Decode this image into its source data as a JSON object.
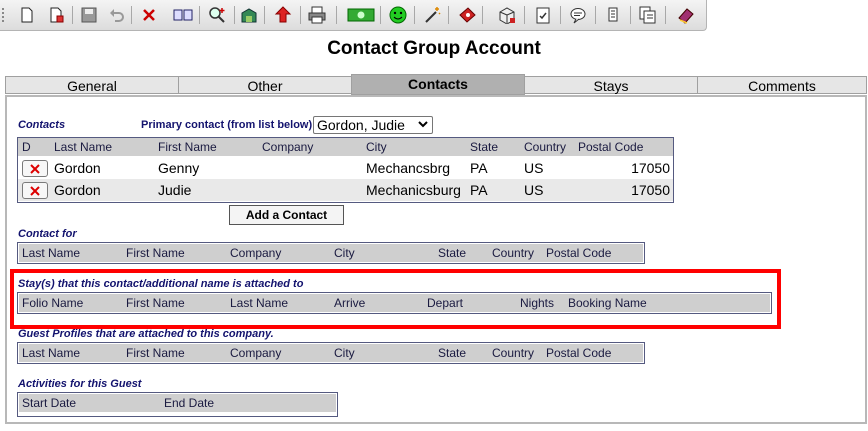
{
  "toolbar": {
    "icons": [
      "new-document-icon",
      "copy-document-icon",
      "save-icon",
      "undo-icon",
      "delete-icon",
      "folders-icon",
      "search-add-icon",
      "building-icon",
      "upload-icon",
      "print-icon",
      "money-icon",
      "smiley-icon",
      "wand-icon",
      "ticket-icon",
      "package-icon",
      "checklist-icon",
      "speech-bubble-icon",
      "scroll-icon",
      "document-stack-icon",
      "book-icon"
    ]
  },
  "page": {
    "title": "Contact Group Account"
  },
  "tabs": [
    {
      "label": "General"
    },
    {
      "label": "Other"
    },
    {
      "label": "Contacts",
      "active": true
    },
    {
      "label": "Stays"
    },
    {
      "label": "Comments"
    }
  ],
  "contacts": {
    "section_label": "Contacts",
    "primary_label": "Primary contact (from list below)",
    "primary_selected": "Gordon, Judie",
    "columns": [
      "D",
      "Last Name",
      "First Name",
      "Company",
      "City",
      "State",
      "Country",
      "Postal Code"
    ],
    "rows": [
      {
        "last": "Gordon",
        "first": "Genny",
        "company": "",
        "city": "Mechancsbrg",
        "state": "PA",
        "country": "US",
        "postal": "17050"
      },
      {
        "last": "Gordon",
        "first": "Judie",
        "company": "",
        "city": "Mechanicsburg",
        "state": "PA",
        "country": "US",
        "postal": "17050"
      }
    ],
    "add_button": "Add a Contact"
  },
  "contact_for": {
    "section_label": "Contact for",
    "columns": [
      "Last Name",
      "First Name",
      "Company",
      "City",
      "State",
      "Country",
      "Postal Code"
    ]
  },
  "stays": {
    "section_label": "Stay(s) that this contact/additional name is attached to",
    "columns": [
      "Folio Name",
      "First Name",
      "Last Name",
      "Arrive",
      "Depart",
      "Nights",
      "Booking Name"
    ]
  },
  "guest_profiles": {
    "section_label": "Guest Profiles that are attached to this company.",
    "columns": [
      "Last Name",
      "First Name",
      "Company",
      "City",
      "State",
      "Country",
      "Postal Code"
    ]
  },
  "activities": {
    "section_label": "Activities for this Guest",
    "columns": [
      "Start Date",
      "End Date"
    ]
  },
  "colors": {
    "label_blue": "#13136e",
    "highlight": "#ff0000",
    "active_tab": "#b0b0b0"
  }
}
